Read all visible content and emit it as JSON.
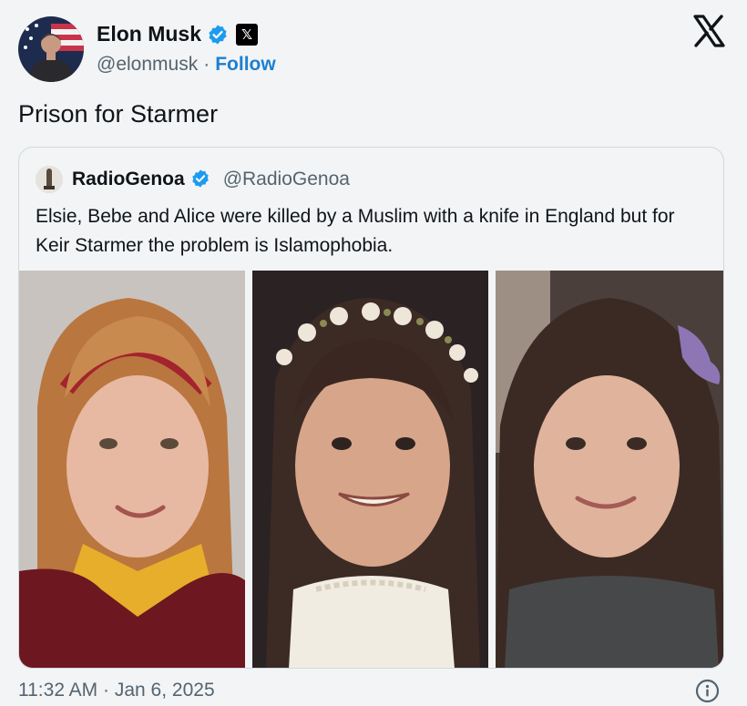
{
  "author": {
    "display_name": "Elon Musk",
    "handle": "@elonmusk",
    "separator": "·",
    "follow_label": "Follow"
  },
  "post": {
    "text": "Prison for Starmer",
    "time": "11:32 AM",
    "separator": "·",
    "date": "Jan 6, 2025"
  },
  "quoted": {
    "display_name": "RadioGenoa",
    "handle": "@RadioGenoa",
    "text": "Elsie, Bebe and Alice were killed by a Muslim with a knife in England but for Keir Starmer the problem is Islamophobia."
  },
  "colors": {
    "link": "#1d7fd0",
    "verified": "#1d9bf0",
    "secondary_text": "#536471"
  },
  "icons": [
    "verified-badge-icon",
    "x-badge-icon",
    "x-logo-icon",
    "info-icon"
  ]
}
